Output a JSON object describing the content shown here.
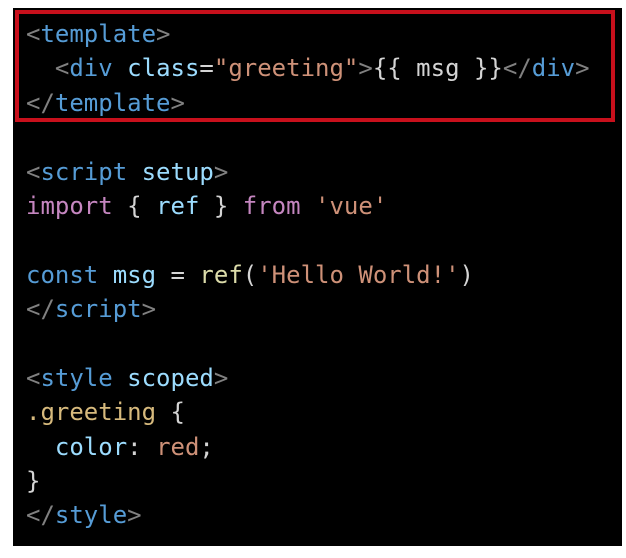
{
  "code": {
    "template_open": "template",
    "div_tag": "div",
    "class_attr": "class",
    "class_value": "\"greeting\"",
    "mustache": "{{ msg }}",
    "template_close": "template",
    "script_open": "script",
    "setup_attr": "setup",
    "import_kw": "import",
    "ref_name": "ref",
    "from_kw": "from",
    "module_name": "'vue'",
    "const_kw": "const",
    "msg_var": "msg",
    "ref_call": "ref",
    "hello_str": "'Hello World!'",
    "script_close": "script",
    "style_open": "style",
    "scoped_attr": "scoped",
    "selector": ".greeting",
    "color_prop": "color",
    "color_value": "red",
    "style_close": "style"
  },
  "colors": {
    "highlight_border": "#c8101c",
    "panel_background": "#000000"
  }
}
